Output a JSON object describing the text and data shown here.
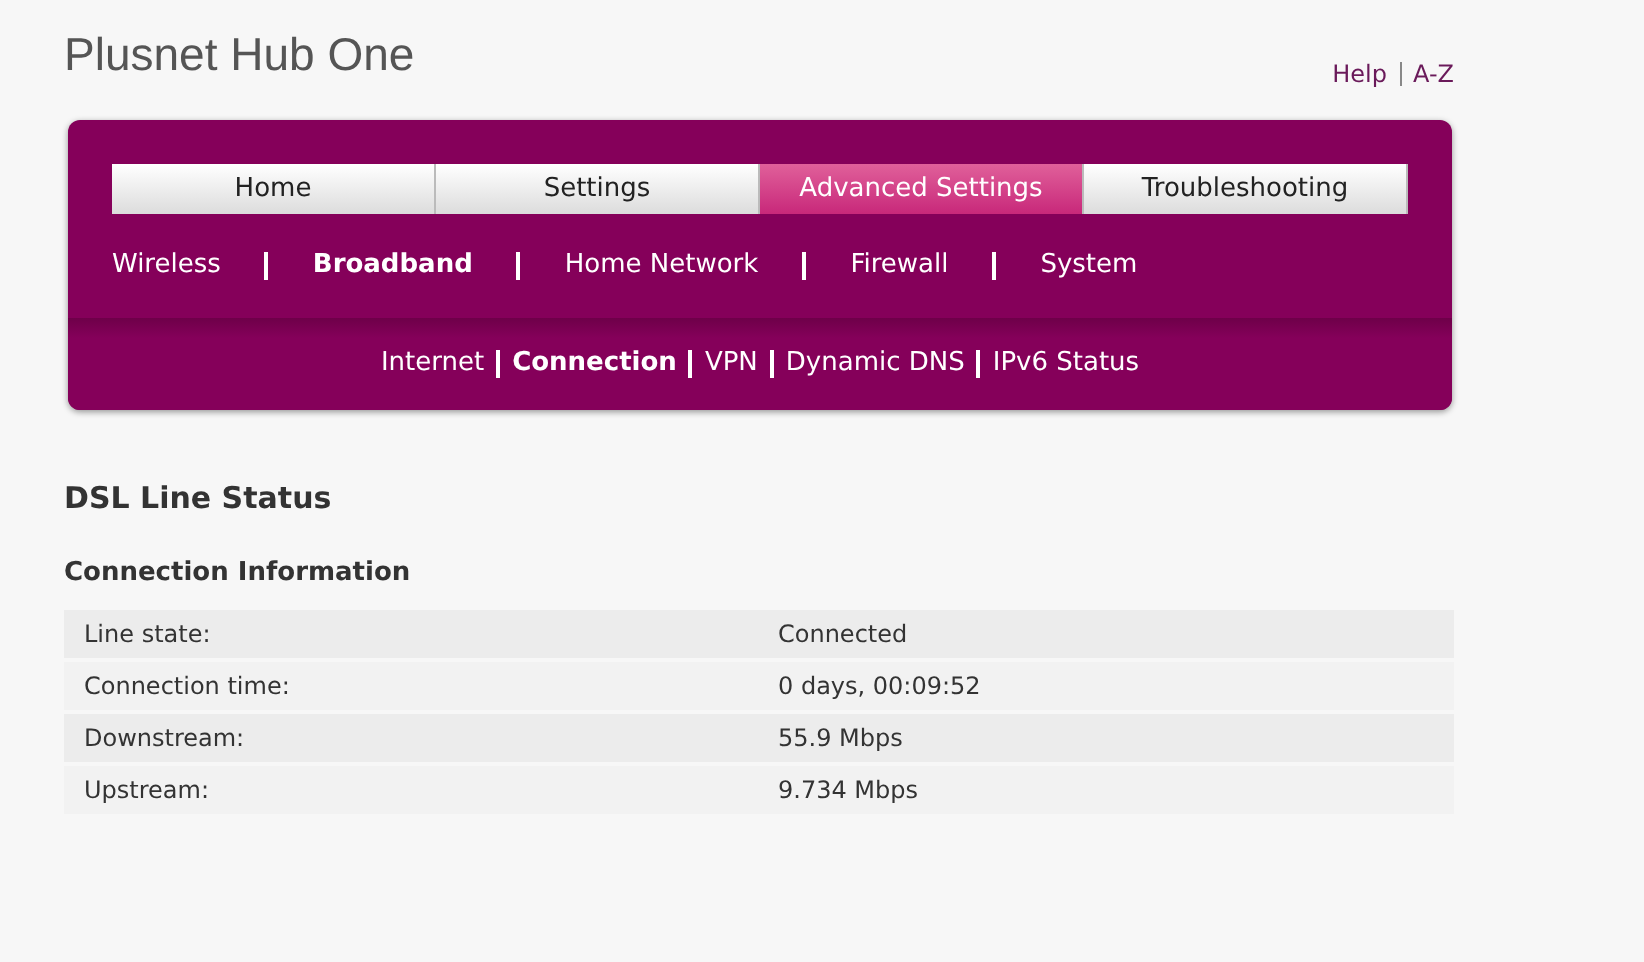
{
  "header": {
    "title": "Plusnet Hub One",
    "links": [
      "Help",
      "A-Z"
    ]
  },
  "tabs": [
    {
      "label": "Home",
      "selected": false
    },
    {
      "label": "Settings",
      "selected": false
    },
    {
      "label": "Advanced Settings",
      "selected": true
    },
    {
      "label": "Troubleshooting",
      "selected": false
    }
  ],
  "subnav": [
    {
      "label": "Wireless",
      "selected": false
    },
    {
      "label": "Broadband",
      "selected": true
    },
    {
      "label": "Home Network",
      "selected": false
    },
    {
      "label": "Firewall",
      "selected": false
    },
    {
      "label": "System",
      "selected": false
    }
  ],
  "subsubnav": [
    {
      "label": "Internet",
      "selected": false
    },
    {
      "label": "Connection",
      "selected": true
    },
    {
      "label": "VPN",
      "selected": false
    },
    {
      "label": "Dynamic DNS",
      "selected": false
    },
    {
      "label": "IPv6 Status",
      "selected": false
    }
  ],
  "page_title": "DSL Line Status",
  "section_title": "Connection Information",
  "rows": [
    {
      "label": "Line state:",
      "value": "Connected"
    },
    {
      "label": "Connection time:",
      "value": "0 days, 00:09:52"
    },
    {
      "label": "Downstream:",
      "value": "55.9 Mbps"
    },
    {
      "label": "Upstream:",
      "value": "9.734 Mbps"
    }
  ]
}
